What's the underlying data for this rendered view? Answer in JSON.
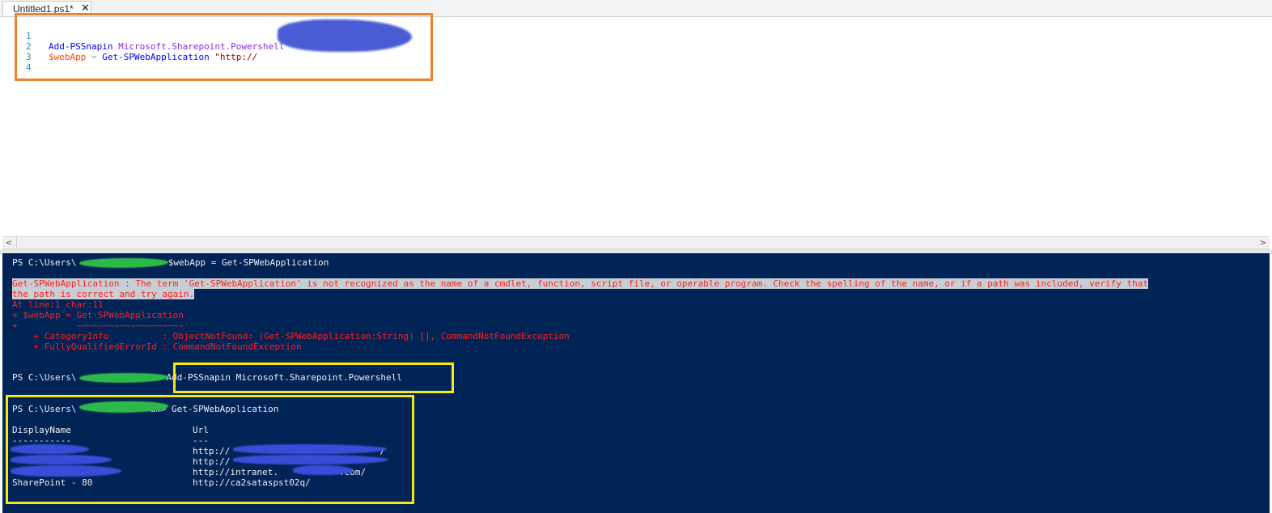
{
  "tab": {
    "title": "Untitled1.ps1*",
    "close_glyph": "✕"
  },
  "editor": {
    "line_numbers": [
      "1",
      "2",
      "3",
      "4"
    ],
    "line1": {
      "cmd": "Add-PSSnapin",
      "arg": "Microsoft.Sharepoint.Powershell"
    },
    "line2": {
      "var": "$webApp",
      "op": "=",
      "cmd": "Get-SPWebApplication",
      "str": "\"http://"
    }
  },
  "scrollbar": {
    "left_arrow": "<",
    "right_arrow": ">"
  },
  "console": {
    "prompt_prefix": "PS C:\\Users\\",
    "prompt1_cmd": "> $webApp = Get-SPWebApplication",
    "error_lines": [
      "Get-SPWebApplication : The term 'Get-SPWebApplication' is not recognized as the name of a cmdlet, function, script file, or operable program. Check the spelling of the name, or if a path was included, verify that",
      "the path is correct and try again.",
      "At line:1 char:11",
      "+ $webApp = Get-SPWebApplication",
      "+           ~~~~~~~~~~~~~~~~~~~~",
      "    + CategoryInfo          : ObjectNotFound: (Get-SPWebApplication:String) [], CommandNotFoundException",
      "    + FullyQualifiedErrorId : CommandNotFoundException"
    ],
    "prompt2_cmd": "Add-PSSnapin Microsoft.Sharepoint.Powershell",
    "prompt3_cmd": "dm> Get-SPWebApplication",
    "table": {
      "headers": [
        "DisplayName",
        "Url"
      ],
      "underlines": [
        "-----------",
        "---"
      ],
      "rows": [
        {
          "name": "",
          "url": "http://"
        },
        {
          "name": "",
          "url": "http://"
        },
        {
          "name": "",
          "url": "http://intranet."
        },
        {
          "name": "SharePoint - 80",
          "url": "http://ca2sataspst02q/"
        }
      ],
      "url_suffixes": [
        "/",
        "",
        ".com/",
        ""
      ]
    }
  },
  "colors": {
    "console_bg": "#012456",
    "error_text": "#ff1e1e",
    "highlight_orange": "#f0822d",
    "highlight_yellow": "#f4e712",
    "redaction_blue": "#3b4fe0",
    "redaction_green": "#2db84a"
  }
}
